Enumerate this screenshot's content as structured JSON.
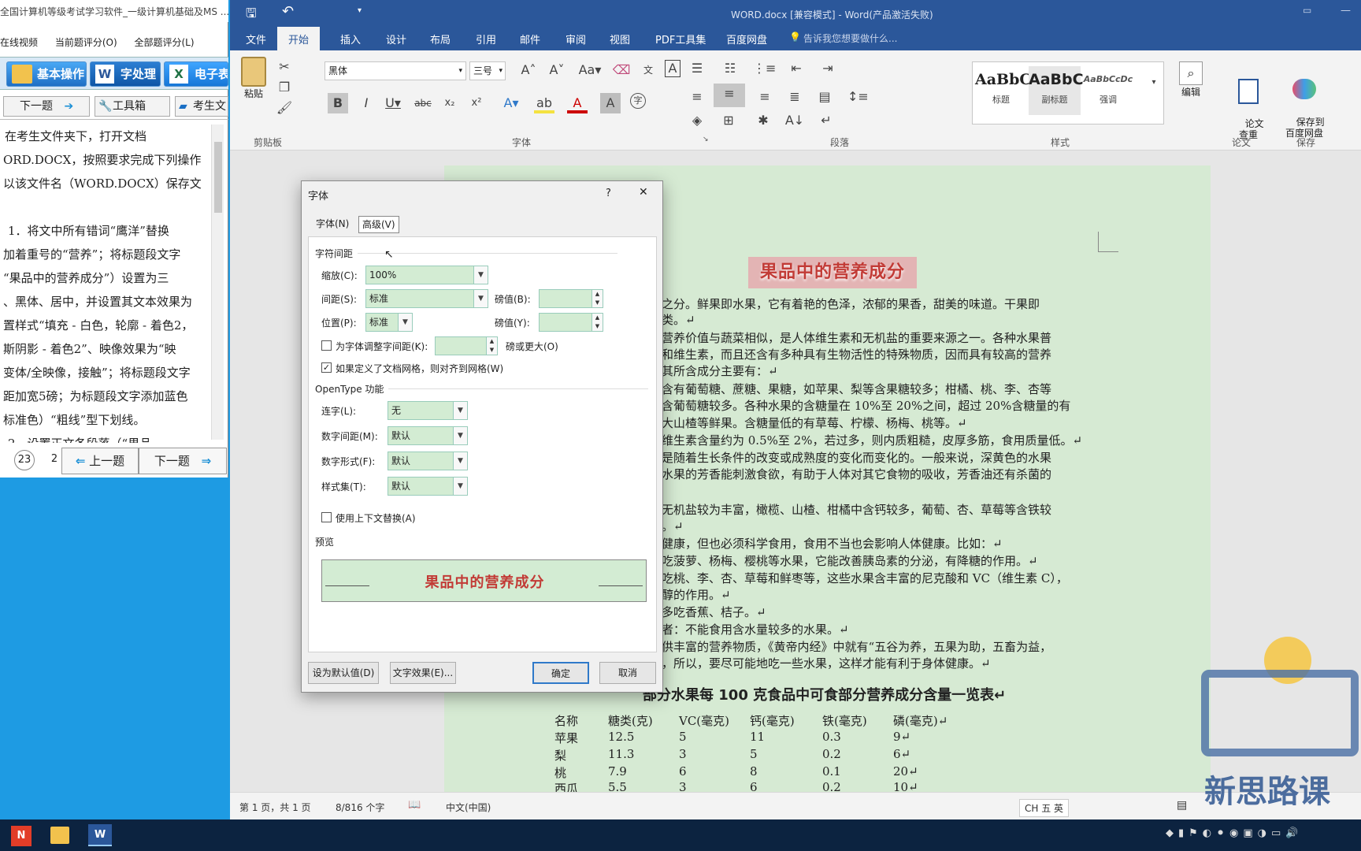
{
  "exam": {
    "title": "全国计算机等级考试学习软件_一级计算机基础及MS ...",
    "menu": [
      "在线视频",
      "当前题评分(O)",
      "全部题评分(L)"
    ],
    "tabs": [
      "基本操作",
      "字处理",
      "电子表格"
    ],
    "tools": [
      "下一题",
      "工具箱",
      "考生文"
    ],
    "text_lines": [
      "在考生文件夹下，打开文档",
      "ORD.DOCX，按照要求完成下列操作",
      "以该文件名（WORD.DOCX）保存文",
      "",
      "1．将文中所有错词“鹰洋”替换",
      "加着重号的“营养”；将标题段文字",
      "“果品中的营养成分”）设置为三",
      "、黑体、居中，并设置其文本效果为",
      "置样式“填充 - 白色，轮廓 - 着色2，",
      "斯阴影 - 着色2”、映像效果为“映",
      "变体/全映像，接触”；将标题段文字",
      "距加宽5磅；为标题段文字添加蓝色",
      "标准色）“粗线”型下划线。",
      "2．设置正文各段落（“果品"
    ],
    "page_nums": [
      "23",
      "2"
    ],
    "prev": "上一题",
    "next": "下一题"
  },
  "word": {
    "window_title": "WORD.docx [兼容模式] - Word(产品激活失败)",
    "ribbon_tabs": [
      "文件",
      "开始",
      "插入",
      "设计",
      "布局",
      "引用",
      "邮件",
      "审阅",
      "视图",
      "PDF工具集",
      "百度网盘"
    ],
    "tell_me": "告诉我您想要做什么...",
    "font_name": "黑体",
    "font_size": "三号",
    "groups": {
      "clipboard": "剪贴板",
      "font": "字体",
      "paragraph": "段落",
      "styles": "样式",
      "paper": "论文",
      "save": "保存"
    },
    "paste_label": "粘贴",
    "styles": [
      {
        "sample": "AaBbC",
        "name": "标题"
      },
      {
        "sample": "AaBbC",
        "name": "副标题"
      },
      {
        "sample": "AaBbCcDc",
        "name": "强调"
      }
    ],
    "edit_label": "编辑",
    "paper_check": "论文\n查重",
    "save_baidu": "保存到\n百度网盘"
  },
  "document": {
    "heading": "果品中的营养成分",
    "lines": [
      "之分。鲜果即水果，它有着艳的色泽，浓郁的果香，甜美的味道。干果即",
      "类。↵",
      "营养价值与蔬菜相似，是人体维生素和无机盐的重要来源之一。各种水果普",
      "和维生素，而且还含有多种具有生物活性的特殊物质，因而具有较高的营养",
      "其所含成分主要有：↵",
      "含有葡萄糖、蔗糖、果糖，如苹果、梨等含果糖较多；柑橘、桃、李、杏等",
      "含葡萄糖较多。各种水果的含糖量在 10%至 20%之间，超过 20%含糖量的有",
      "大山楂等鲜果。含糖量低的有草莓、柠檬、杨梅、桃等。↵",
      "维生素含量约为 0.5%至 2%，若过多，则内质粗糙，皮厚多筋，食用质量低。↵",
      "是随着生长条件的改变或成熟度的变化而变化的。一般来说，深黄色的水果",
      "水果的芳香能刺激食欲，有助于人体对其它食物的吸收，芳香油还有杀菌的",
      "",
      "无机盐较为丰富，橄榄、山楂、柑橘中含钙较多，葡萄、杏、草莓等含铁较",
      "。↵",
      "健康，但也必须科学食用，食用不当也会影响人体健康。比如：↵",
      "吃菠萝、杨梅、樱桃等水果，它能改善胰岛素的分泌，有降糖的作用。↵",
      "吃桃、李、杏、草莓和鲜枣等，这些水果含丰富的尼克酸和 VC（维生素 C），",
      "醇的作用。↵",
      "多吃香蕉、桔子。↵",
      "者：不能食用含水量较多的水果。↵",
      "供丰富的营养物质，《黄帝内经》中就有“五谷为养，五果为助，五畜为益，",
      "，所以，要尽可能地吃一些水果，这样才能有利于身体健康。↵"
    ],
    "table_title": "部分水果每 100 克食品中可食部分营养成分含量一览表↵",
    "table_header": [
      "名称",
      "糖类(克)",
      "VC(毫克)",
      "钙(毫克)",
      "铁(毫克)",
      "磷(毫克)↵"
    ],
    "table_rows": [
      [
        "苹果",
        "12.5",
        "5",
        "11",
        "0.3",
        "9↵"
      ],
      [
        "梨",
        "11.3",
        "3",
        "5",
        "0.2",
        "6↵"
      ],
      [
        "桃",
        "7.9",
        "6",
        "8",
        "0.1",
        "20↵"
      ],
      [
        "西瓜",
        "5.5",
        "3",
        "6",
        "0.2",
        "10↵"
      ]
    ]
  },
  "status": {
    "page": "第 1 页，共 1 页",
    "words": "8/816 个字",
    "lang": "中文(中国)",
    "ime": "CH 五 英"
  },
  "dialog": {
    "title": "字体",
    "help": "?",
    "close": "✕",
    "tabs": [
      "字体(N)",
      "高级(V)"
    ],
    "section_spacing": "字符间距",
    "scale_label": "缩放(C):",
    "scale_value": "100%",
    "spacing_label": "间距(S):",
    "spacing_value": "标准",
    "spacing_by_label": "磅值(B):",
    "position_label": "位置(P):",
    "position_value": "标准",
    "position_by_label": "磅值(Y):",
    "kerning_label": "为字体调整字间距(K):",
    "kerning_suffix": "磅或更大(O)",
    "grid_label": "如果定义了文档网格，则对齐到网格(W)",
    "section_opentype": "OpenType 功能",
    "ligature_label": "连字(L):",
    "ligature_value": "无",
    "numspacing_label": "数字间距(M):",
    "numspacing_value": "默认",
    "numform_label": "数字形式(F):",
    "numform_value": "默认",
    "styleset_label": "样式集(T):",
    "styleset_value": "默认",
    "contextual_label": "使用上下文替换(A)",
    "preview_label": "预览",
    "preview_text": "果品中的营养成分",
    "btn_default": "设为默认值(D)",
    "btn_effects": "文字效果(E)...",
    "btn_ok": "确定",
    "btn_cancel": "取消"
  },
  "brand": {
    "watermark": "新思路课"
  },
  "colors": {
    "word_blue": "#2b579a",
    "heading_red": "#c23b36",
    "page_green": "#d6ead3"
  }
}
